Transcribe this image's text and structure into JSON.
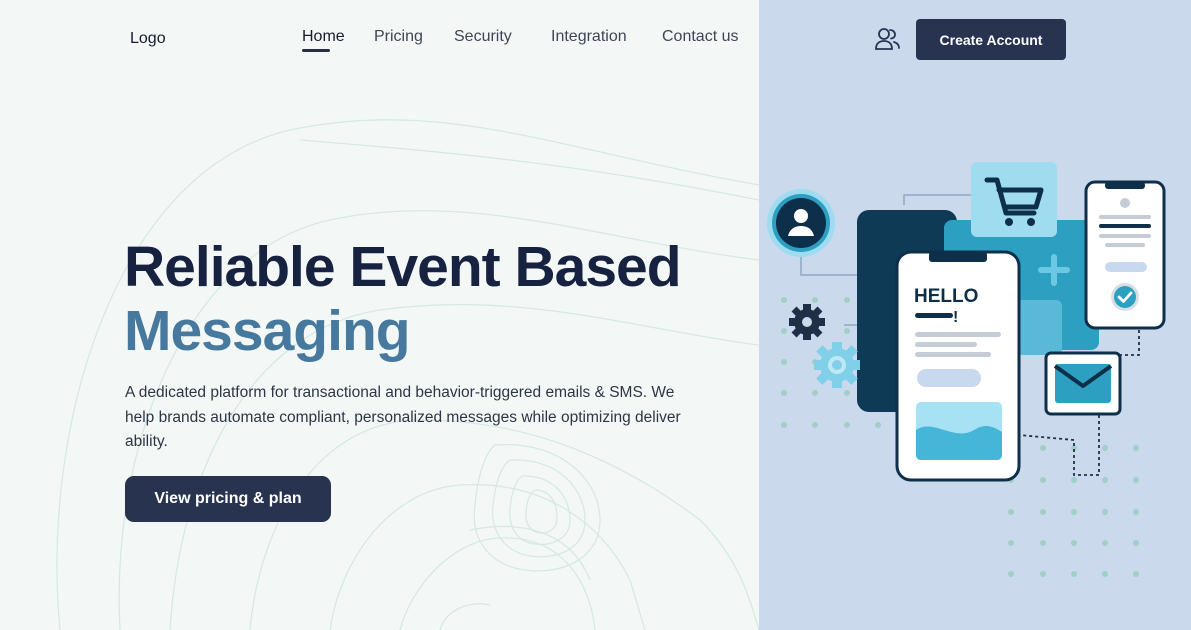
{
  "header": {
    "logo": "Logo",
    "nav": [
      {
        "label": "Home",
        "active": true
      },
      {
        "label": "Pricing",
        "active": false
      },
      {
        "label": "Security",
        "active": false
      },
      {
        "label": "Integration",
        "active": false
      },
      {
        "label": "Contact us",
        "active": false
      }
    ],
    "account_icon": "users-icon",
    "create_account_label": "Create Account"
  },
  "hero": {
    "title_line1": "Reliable Event Based",
    "title_line2": "Messaging",
    "description": "A dedicated platform for transactional and behavior-triggered emails & SMS. We help brands automate compliant, personalized messages while optimizing deliver ability.",
    "cta_label": "View pricing & plan"
  },
  "illustration": {
    "phone_greeting_line1": "HELLO",
    "phone_greeting_line2": "!",
    "icons": [
      "avatar-icon",
      "cart-icon",
      "gear-icon",
      "envelope-icon",
      "check-icon",
      "plus-icon"
    ]
  },
  "colors": {
    "primary_dark": "#27334f",
    "heading": "#172140",
    "accent_blue": "#46799d",
    "right_panel": "#cbd9ec",
    "page_bg": "#f3f8f6"
  }
}
